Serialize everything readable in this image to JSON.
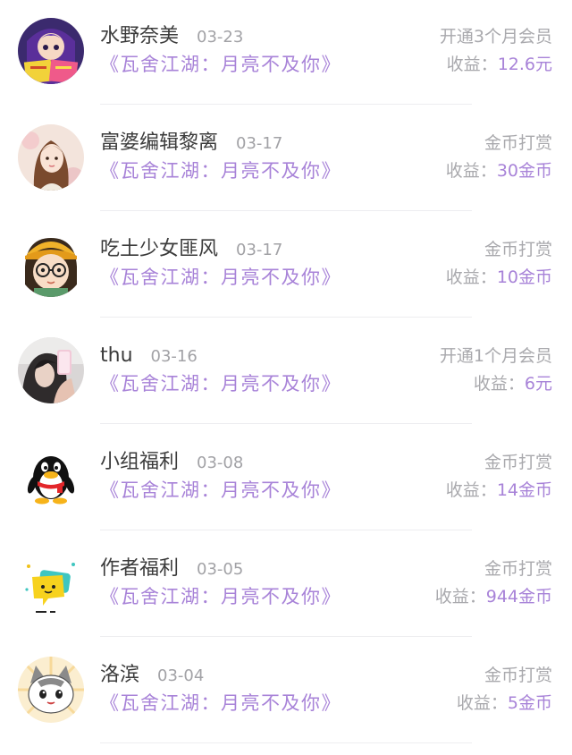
{
  "colors": {
    "accent_purple": "#a883d8",
    "name_text": "#3b3b3b",
    "muted_text": "#a9a9ad",
    "divider": "#ededf0"
  },
  "income_label": "收益：",
  "records": [
    {
      "name": "水野奈美",
      "date": "03-23",
      "book": "《瓦舍江湖：月亮不及你》",
      "type": "开通3个月会员",
      "income": "12.6元",
      "avatar_icon": "anime-girl-reading-avatar"
    },
    {
      "name": "富婆编辑黎离",
      "date": "03-17",
      "book": "《瓦舍江湖：月亮不及你》",
      "type": "金币打赏",
      "income": "30金币",
      "avatar_icon": "illustrated-woman-avatar"
    },
    {
      "name": "吃土少女匪风",
      "date": "03-17",
      "book": "《瓦舍江湖：月亮不及你》",
      "type": "金币打赏",
      "income": "10金币",
      "avatar_icon": "cartoon-girl-glasses-avatar"
    },
    {
      "name": "thu",
      "date": "03-16",
      "book": "《瓦舍江湖：月亮不及你》",
      "type": "开通1个月会员",
      "income": "6元",
      "avatar_icon": "selfie-photo-avatar"
    },
    {
      "name": "小组福利",
      "date": "03-08",
      "book": "《瓦舍江湖：月亮不及你》",
      "type": "金币打赏",
      "income": "14金币",
      "avatar_icon": "penguin-avatar"
    },
    {
      "name": "作者福利",
      "date": "03-05",
      "book": "《瓦舍江湖：月亮不及你》",
      "type": "金币打赏",
      "income": "944金币",
      "avatar_icon": "yellow-chat-bubble-avatar"
    },
    {
      "name": "洛滨",
      "date": "03-04",
      "book": "《瓦舍江湖：月亮不及你》",
      "type": "金币打赏",
      "income": "5金币",
      "avatar_icon": "cartoon-cat-avatar"
    }
  ]
}
